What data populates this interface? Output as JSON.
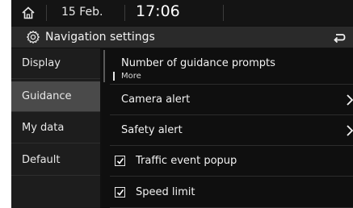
{
  "status_bar": {
    "date": "15 Feb.",
    "time": "17:06"
  },
  "title_bar": {
    "title": "Navigation settings"
  },
  "menu": {
    "items": [
      {
        "label": "Display",
        "selected": false
      },
      {
        "label": "Guidance",
        "selected": true
      },
      {
        "label": "My data",
        "selected": false
      },
      {
        "label": "Default",
        "selected": false
      }
    ]
  },
  "settings": {
    "guidance_prompts": {
      "label": "Number of guidance prompts",
      "value": "More"
    },
    "camera_alert": {
      "label": "Camera alert"
    },
    "safety_alert": {
      "label": "Safety alert"
    },
    "traffic_event_popup": {
      "label": "Traffic event popup",
      "checked": true
    },
    "speed_limit": {
      "label": "Speed limit",
      "checked": true
    }
  },
  "colors": {
    "background": "#101010",
    "selected_menu": "#4a4a4a",
    "title_bar": "#2a2a2a"
  }
}
